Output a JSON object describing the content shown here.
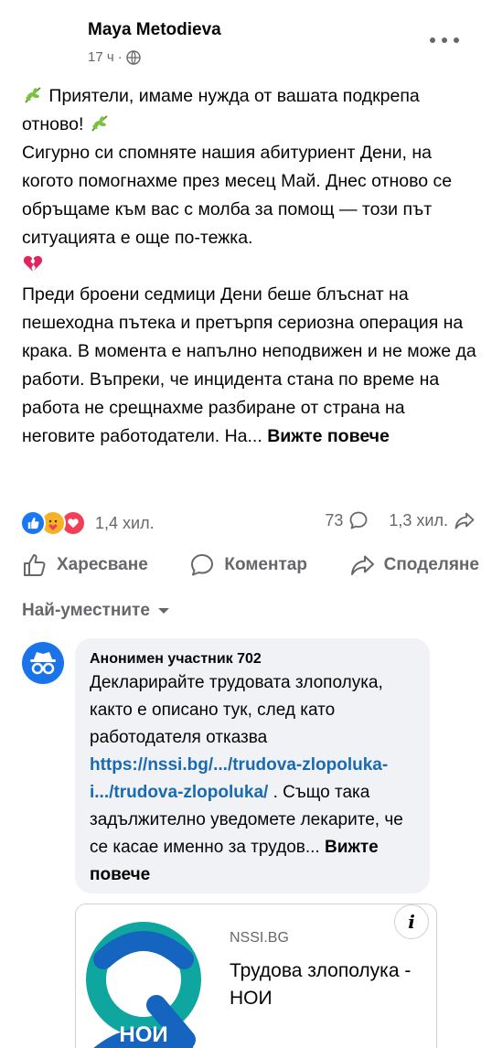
{
  "post": {
    "author": "Maya Metodieva",
    "time": "17 ч",
    "line1": "Приятели, имаме нужда от вашата подкрепа отново!",
    "para2": "Сигурно си спомняте нашия абитуриент Дени, на когото помогнахме през месец Май. Днес отново се обръщаме към вас с молба за помощ — този път ситуацията е още по-тежка.",
    "para3": "Преди броени седмици Дени беше блъснат на пешеходна пътека и претърпя сериозна операция на крака. В момента е напълно неподвижен и не може да работи. Въпреки, че инцидента стана по време на работа не срещнахме разбиране от страна на неговите работодатели. На...",
    "see_more": "Вижте повече"
  },
  "reactions": {
    "count": "1,4 хил.",
    "comments": "73",
    "shares": "1,3 хил."
  },
  "actions": {
    "like": "Харесване",
    "comment": "Коментар",
    "share": "Споделяне"
  },
  "sort_label": "Най-уместните",
  "comment": {
    "author": "Анонимен участник 702",
    "text1": "Декларирайте трудовата злополука, както е описано тук, след като работодателя отказва",
    "link": "https://nssi.bg/.../trudova-zlopoluka-i.../trudova-zlopoluka/",
    "text2": ". Също така задължително уведомете лекарите, че се касае именно за трудов...",
    "see_more": "Вижте повече"
  },
  "link_card": {
    "domain": "NSSI.BG",
    "title": "Трудова злополука - НОИ",
    "logo_text": "НОИ"
  },
  "colors": {
    "accent_blue": "#1877f2",
    "link_blue": "#1a6ab1",
    "love_red": "#f33e58",
    "care_yellow": "#f7b125",
    "noi_teal": "#0fa6a0",
    "noi_blue": "#1565c0",
    "text_secondary": "#65676b"
  }
}
